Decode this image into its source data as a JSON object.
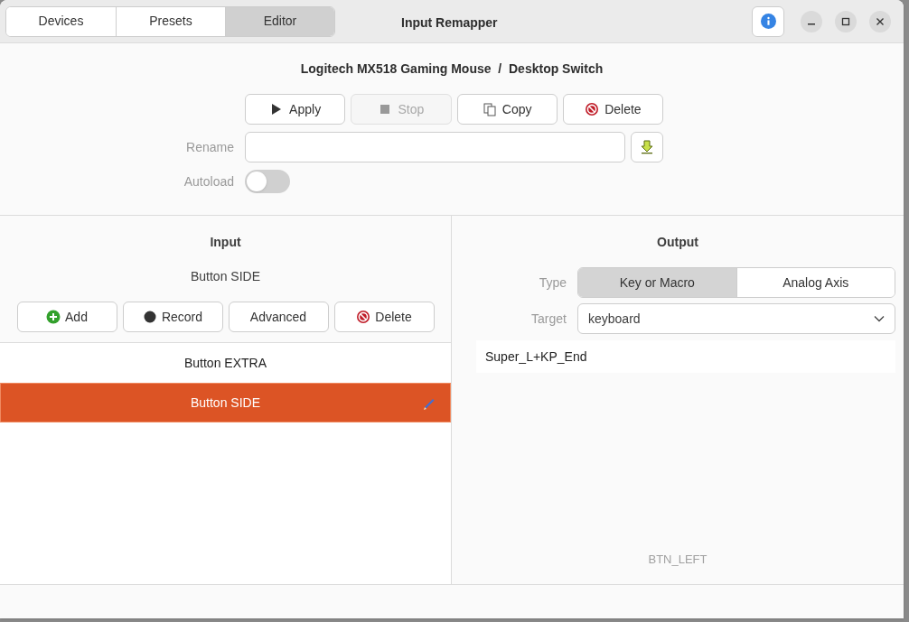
{
  "header_tabs": [
    {
      "label": "Devices",
      "selected": false
    },
    {
      "label": "Presets",
      "selected": false
    },
    {
      "label": "Editor",
      "selected": true
    }
  ],
  "window": {
    "title": "Input Remapper"
  },
  "preset_title": "Logitech MX518 Gaming Mouse  /  Desktop Switch",
  "preset_buttons": [
    {
      "label": "Apply",
      "kind": "play",
      "disabled": false
    },
    {
      "label": "Stop",
      "kind": "stop",
      "disabled": true
    },
    {
      "label": "Copy",
      "kind": "copy",
      "disabled": false
    },
    {
      "label": "Delete",
      "kind": "delete",
      "disabled": false
    }
  ],
  "rename": {
    "label": "Rename"
  },
  "autoload": {
    "label": "Autoload",
    "on": false
  },
  "input": {
    "heading": "Input",
    "selected_name": "Button SIDE",
    "buttons": [
      {
        "label": "Add",
        "kind": "add"
      },
      {
        "label": "Record",
        "kind": "record"
      },
      {
        "label": "Advanced",
        "kind": "plain"
      },
      {
        "label": "Delete",
        "kind": "delete"
      }
    ],
    "mappings": [
      {
        "label": "Button EXTRA",
        "selected": false
      },
      {
        "label": "Button SIDE",
        "selected": true
      }
    ]
  },
  "output": {
    "heading": "Output",
    "type_label": "Type",
    "types": [
      {
        "label": "Key or Macro",
        "selected": true
      },
      {
        "label": "Analog Axis",
        "selected": false
      }
    ],
    "target_label": "Target",
    "target": "keyboard",
    "macro": "Super_L+KP_End",
    "hint": "BTN_LEFT"
  }
}
